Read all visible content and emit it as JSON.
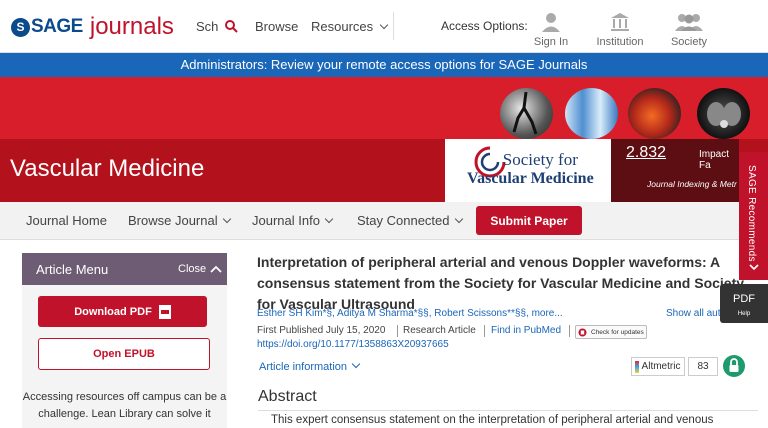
{
  "header": {
    "logo_mark": "S",
    "logo_sage": "SAGE",
    "logo_journals": "journals",
    "search_label": "Sch",
    "browse_label": "Browse",
    "resources_label": "Resources",
    "access_options_label": "Access Options:",
    "sign_in_label": "Sign In",
    "institution_label": "Institution",
    "society_label": "Society"
  },
  "admin_banner": "Administrators: Review your remote access options for SAGE Journals",
  "journal": {
    "title": "Vascular Medicine",
    "society_line1": "Society for",
    "society_line2": "Vascular Medicine",
    "impact_value": "2.832",
    "impact_label": "Impact Fa",
    "indexing_label": "Journal Indexing & Metr"
  },
  "nav": {
    "items": [
      "Journal Home",
      "Browse Journal",
      "Journal Info",
      "Stay Connected"
    ],
    "submit_label": "Submit Paper"
  },
  "article_menu": {
    "title": "Article Menu",
    "close_label": "Close",
    "download_pdf_label": "Download PDF",
    "open_epub_label": "Open EPUB",
    "lean_library_text": "Accessing resources off campus can be a challenge. Lean Library can solve it"
  },
  "article": {
    "title": "Interpretation of peripheral arterial and venous Doppler waveforms: A consensus statement from the Society for Vascular Medicine and Society for Vascular Ultrasound",
    "authors": "Esther SH Kim*§, Aditya M Sharma*§§, Robert Scissons**§§, more...",
    "show_all_label": "Show all aut",
    "published": "First Published July 15, 2020",
    "type": "Research Article",
    "pubmed_label": "Find in PubMed",
    "check_updates_label": "Check for updates",
    "doi": "https://doi.org/10.1177/1358863X20937665",
    "info_label": "Article information",
    "altmetric_label": "Altmetric",
    "altmetric_score": "83",
    "abstract_heading": "Abstract",
    "abstract_text": "This expert consensus statement on the interpretation of peripheral arterial and venous"
  },
  "side_tabs": {
    "recommends_label": "SAGE Recommends",
    "pdf_label": "PDF",
    "help_label": "Help"
  },
  "colors": {
    "brand_red": "#c0122b",
    "banner_blue": "#1a66b8",
    "sage_blue": "#0b4a8b",
    "menu_purple": "#6d5c73"
  }
}
